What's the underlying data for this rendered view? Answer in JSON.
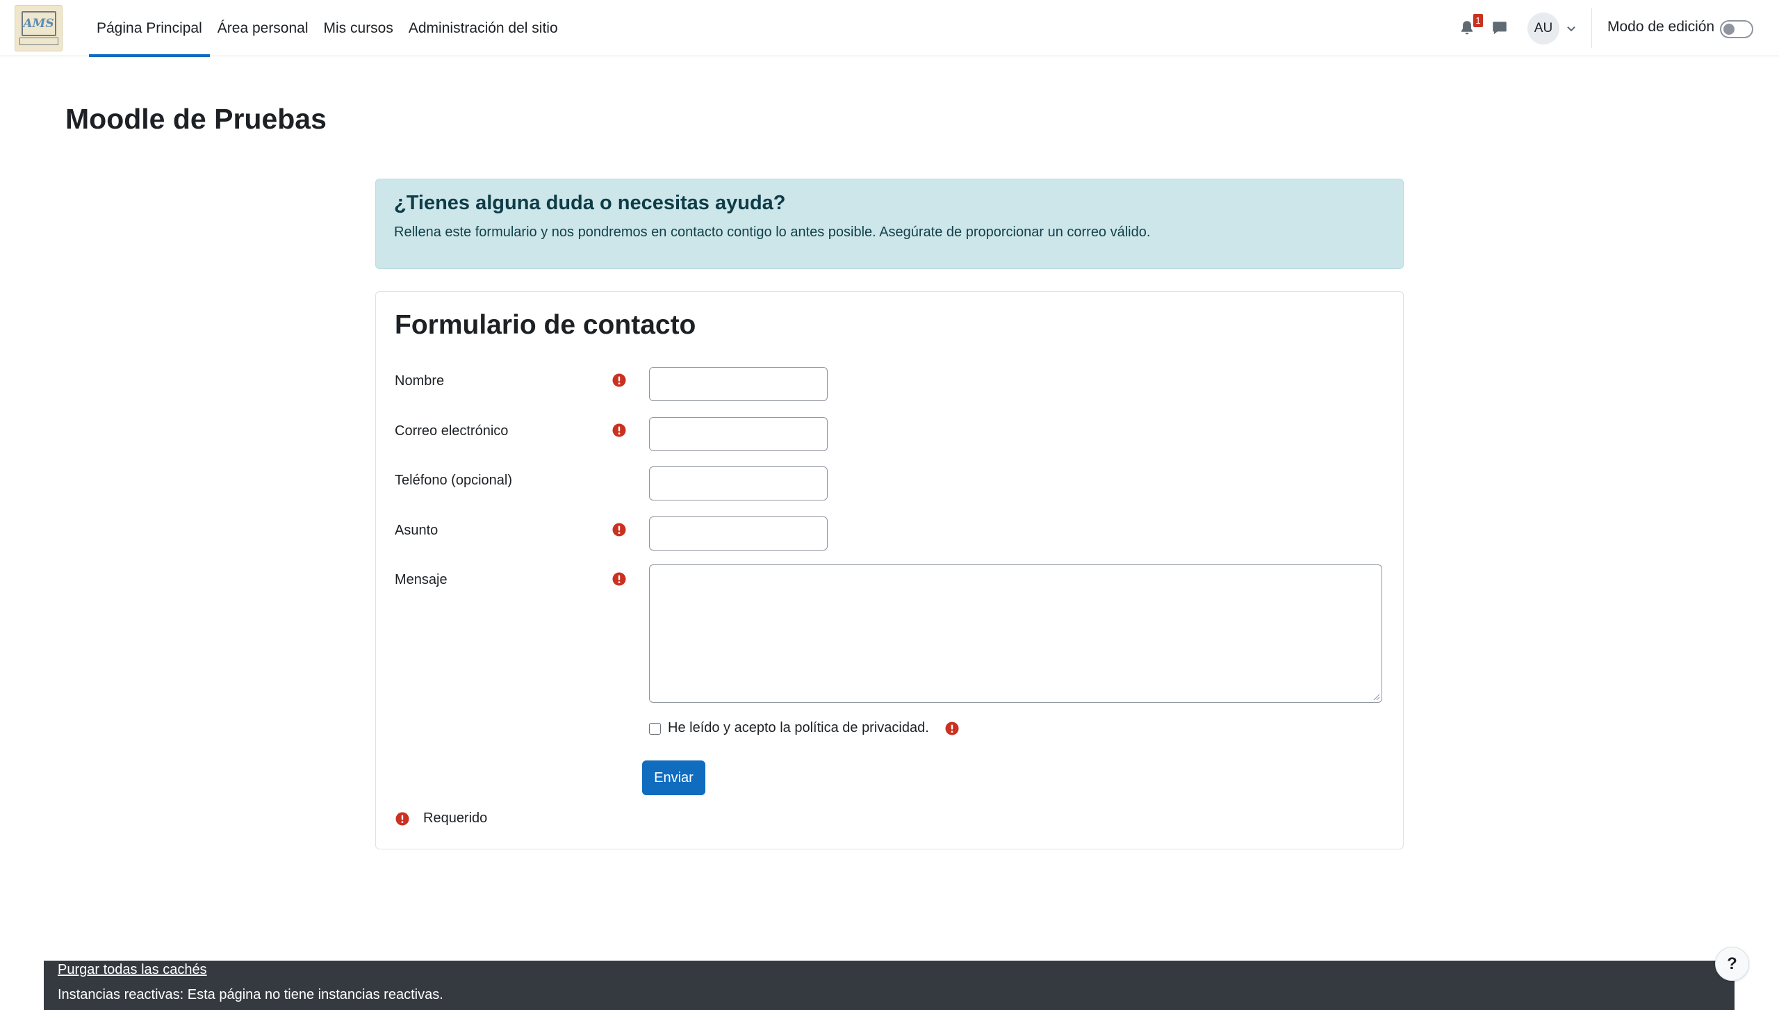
{
  "navbar": {
    "links": [
      {
        "label": "Página Principal",
        "active": true
      },
      {
        "label": "Área personal",
        "active": false
      },
      {
        "label": "Mis cursos",
        "active": false
      },
      {
        "label": "Administración del sitio",
        "active": false
      }
    ],
    "notification_count": "1",
    "user_initials": "AU",
    "edit_mode_label": "Modo de edición",
    "edit_mode_on": false
  },
  "page": {
    "title": "Moodle de Pruebas"
  },
  "alert": {
    "heading": "¿Tienes alguna duda o necesitas ayuda?",
    "text": "Rellena este formulario y nos pondremos en contacto contigo lo antes posible. Asegúrate de proporcionar un correo válido."
  },
  "form": {
    "title": "Formulario de contacto",
    "fields": {
      "name": {
        "label": "Nombre",
        "value": "",
        "required": true
      },
      "email": {
        "label": "Correo electrónico",
        "value": "",
        "required": true
      },
      "phone": {
        "label": "Teléfono (opcional)",
        "value": "",
        "required": false
      },
      "subject": {
        "label": "Asunto",
        "value": "",
        "required": true
      },
      "message": {
        "label": "Mensaje",
        "value": "",
        "required": true
      }
    },
    "privacy_label": "He leído y acepto la política de privacidad.",
    "privacy_checked": false,
    "submit_label": "Enviar",
    "required_legend": "Requerido"
  },
  "footer": {
    "purge_link": "Purgar todas las cachés",
    "reactive_text": "Instancias reactivas: Esta página no tiene instancias reactivas."
  },
  "help_button_label": "?",
  "colors": {
    "primary": "#0f6cbf",
    "danger": "#ca3120",
    "alert_bg": "#cce6ea",
    "footer_bg": "#343a40"
  }
}
